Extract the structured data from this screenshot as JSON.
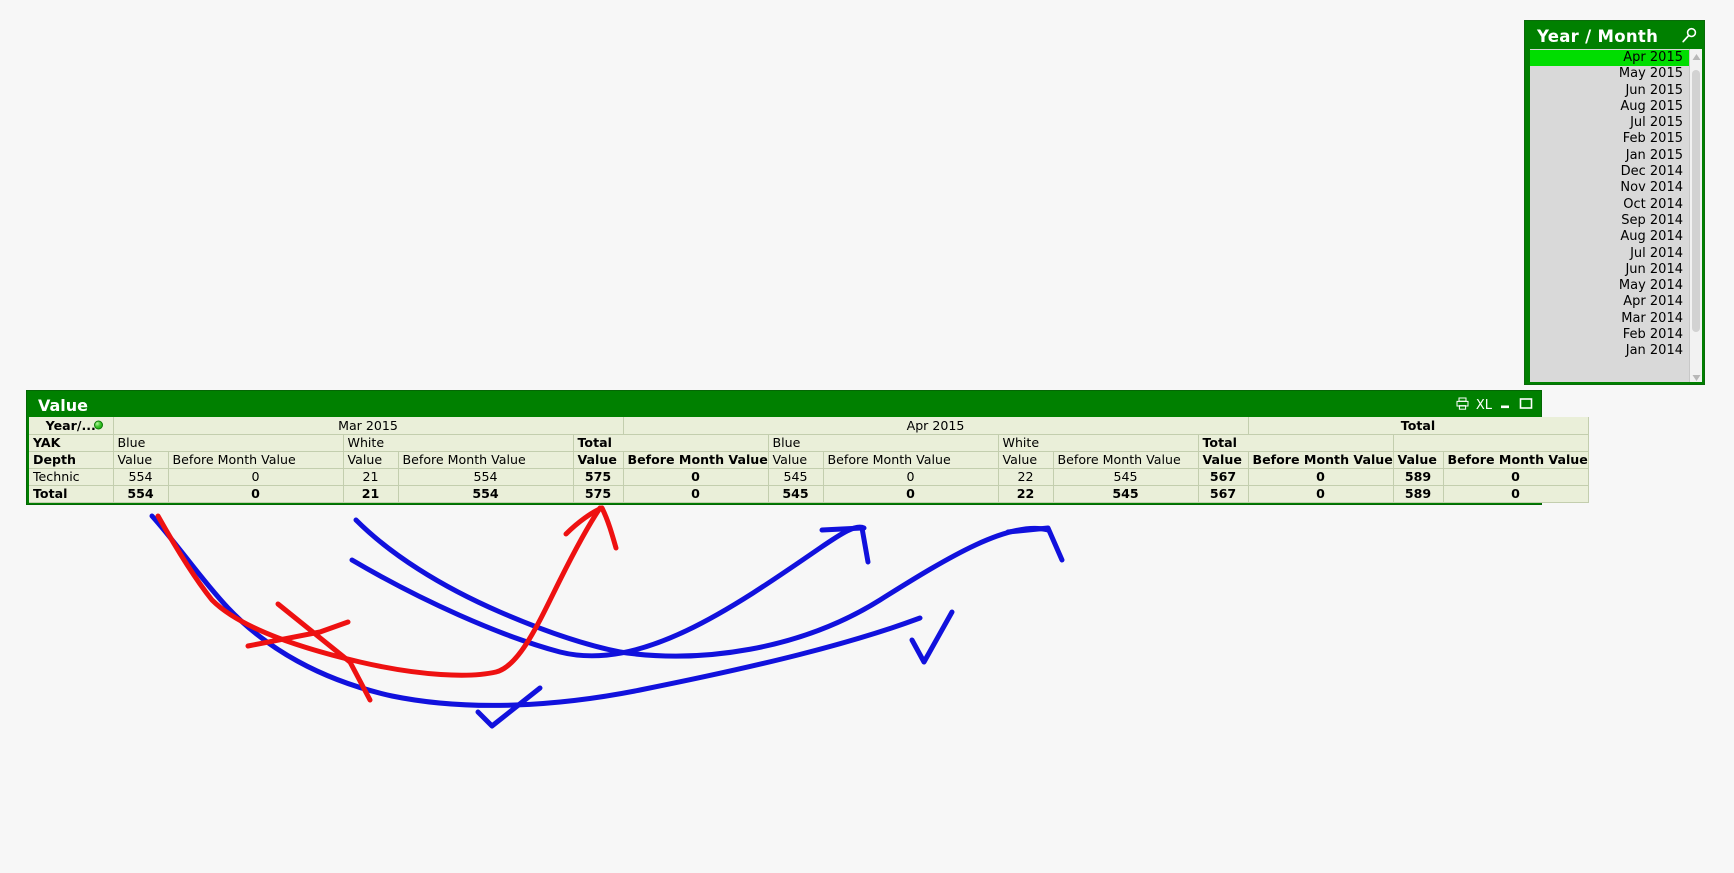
{
  "listbox": {
    "title": "Year / Month",
    "search_icon": "magnifier-icon",
    "selected": "Apr 2015",
    "items": [
      "Apr 2015",
      "May 2015",
      "Jun 2015",
      "Aug 2015",
      "Jul 2015",
      "Feb 2015",
      "Jan 2015",
      "Dec 2014",
      "Nov 2014",
      "Oct 2014",
      "Sep 2014",
      "Aug 2014",
      "Jul 2014",
      "Jun 2014",
      "May 2014",
      "Apr 2014",
      "Mar 2014",
      "Feb 2014",
      "Jan 2014"
    ],
    "scroll": {
      "up_arrow": "triangle-up-icon",
      "down_arrow": "triangle-down-icon"
    }
  },
  "value_window": {
    "title": "Value",
    "icons": [
      {
        "name": "print-icon",
        "label": ""
      },
      {
        "name": "export-xl-icon",
        "label": "XL"
      },
      {
        "name": "minimize-icon",
        "label": ""
      },
      {
        "name": "maximize-icon",
        "label": ""
      }
    ],
    "dimensions": {
      "year_month": "Year/...",
      "yak": "YAK",
      "depth": "Depth"
    },
    "periods": [
      "Mar 2015",
      "Apr 2015",
      "Total"
    ],
    "colors": [
      "Blue",
      "White",
      "Total"
    ],
    "measures": [
      "Value",
      "Before Month Value"
    ],
    "rows": [
      {
        "label": "Technic",
        "is_total": false,
        "cells": [
          "554",
          "0",
          "21",
          "554",
          "575",
          "0",
          "545",
          "0",
          "22",
          "545",
          "567",
          "0",
          "589",
          "0"
        ]
      },
      {
        "label": "Total",
        "is_total": true,
        "cells": [
          "554",
          "0",
          "21",
          "554",
          "575",
          "0",
          "545",
          "0",
          "22",
          "545",
          "567",
          "0",
          "589",
          "0"
        ]
      }
    ]
  },
  "annotation_colors": {
    "red": "#ee1111",
    "blue": "#1111dd"
  }
}
